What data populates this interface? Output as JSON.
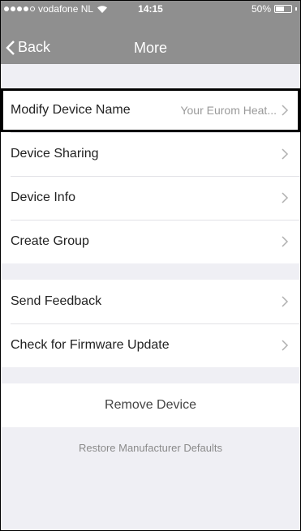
{
  "status_bar": {
    "carrier": "vodafone NL",
    "time": "14:15",
    "battery": "50%",
    "battery_level": 0.5
  },
  "nav": {
    "back_label": "Back",
    "title": "More"
  },
  "device_group": [
    {
      "label": "Modify Device Name",
      "value": "Your Eurom Heat..."
    },
    {
      "label": "Device Sharing",
      "value": ""
    },
    {
      "label": "Device Info",
      "value": ""
    },
    {
      "label": "Create Group",
      "value": ""
    }
  ],
  "support_group": [
    {
      "label": "Send Feedback"
    },
    {
      "label": "Check for Firmware Update"
    }
  ],
  "remove_label": "Remove Device",
  "restore_label": "Restore Manufacturer Defaults",
  "colors": {
    "bar": "#8f8f8f",
    "background": "#efeff4",
    "highlight": "#000000"
  }
}
